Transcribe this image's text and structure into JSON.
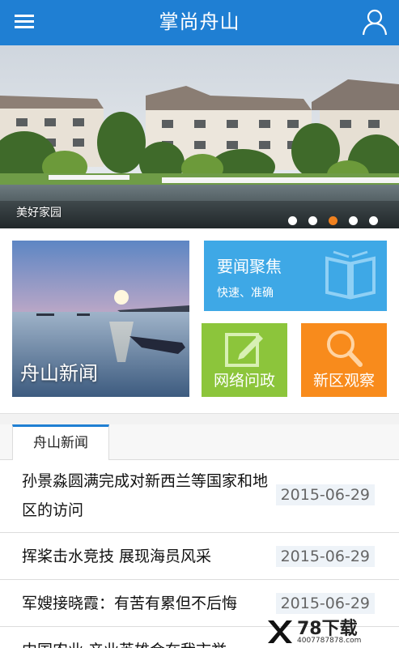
{
  "app": {
    "title": "掌尚舟山"
  },
  "banner": {
    "caption": "美好家园",
    "dots": 5,
    "active_dot": 2
  },
  "tiles": {
    "big": {
      "label": "舟山新闻"
    },
    "focus": {
      "title": "要闻聚焦",
      "subtitle": "快速、准确"
    },
    "green": {
      "label": "网络问政"
    },
    "orange": {
      "label": "新区观察"
    }
  },
  "news": {
    "tab": "舟山新闻",
    "items": [
      {
        "title": "孙景淼圆满完成对新西兰等国家和地区的访问",
        "date": "2015-06-29"
      },
      {
        "title": "挥桨击水竞技 展现海员风采",
        "date": "2015-06-29"
      },
      {
        "title": "军嫂接晓霞：有苦有累但不后悔",
        "date": "2015-06-29"
      },
      {
        "title": "中国农业 产业英雄会在我市举",
        "date": ""
      }
    ]
  },
  "watermark": {
    "text": "78下载",
    "url_text": "4007787878.com"
  },
  "colors": {
    "header": "#1f7fd3",
    "focus_tile": "#3ea8e6",
    "green_tile": "#8cc53b",
    "orange_tile": "#f88b1c",
    "active_dot": "#f0811f"
  }
}
